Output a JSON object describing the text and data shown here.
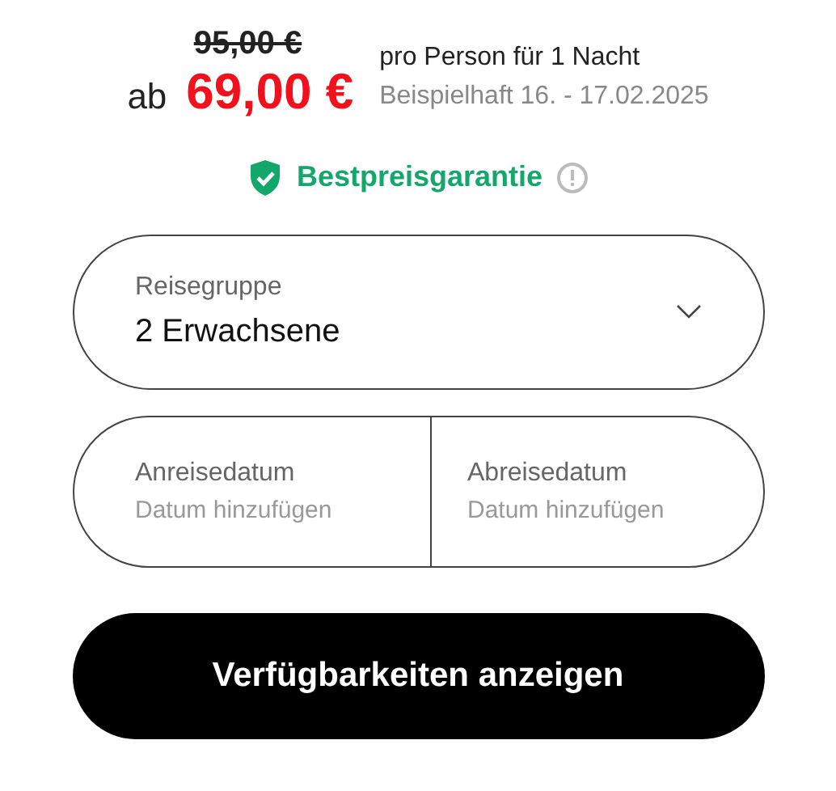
{
  "price": {
    "old": "95,00 €",
    "prefix": "ab",
    "current": "69,00 €",
    "per": "pro Person für 1 Nacht",
    "example": "Beispielhaft 16. - 17.02.2025"
  },
  "guarantee": {
    "label": "Bestpreisgarantie"
  },
  "group": {
    "label": "Reisegruppe",
    "value": "2 Erwachsene"
  },
  "dates": [
    {
      "label": "Anreisedatum",
      "placeholder": "Datum hinzufügen"
    },
    {
      "label": "Abreisedatum",
      "placeholder": "Datum hinzufügen"
    }
  ],
  "button": "Verfügbarkeiten anzeigen"
}
